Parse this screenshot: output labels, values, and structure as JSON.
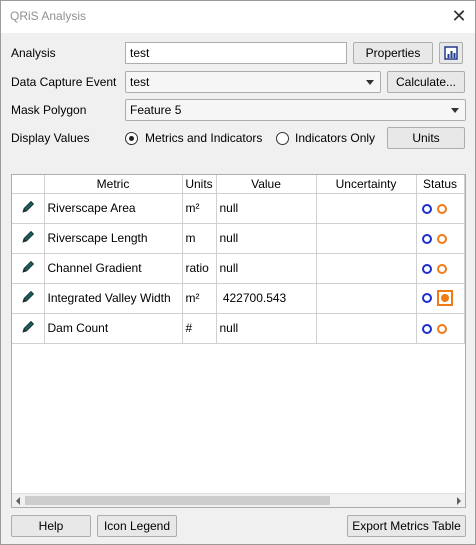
{
  "window": {
    "title": "QRiS Analysis"
  },
  "form": {
    "analysis_label": "Analysis",
    "analysis_value": "test",
    "properties_button": "Properties",
    "dce_label": "Data Capture Event",
    "dce_value": "test",
    "calculate_button": "Calculate...",
    "mask_label": "Mask Polygon",
    "mask_value": "Feature 5",
    "display_label": "Display Values",
    "radio_metrics": "Metrics and Indicators",
    "radio_indicators": "Indicators Only",
    "units_button": "Units",
    "selected_radio": "Metrics and Indicators"
  },
  "table": {
    "headers": [
      "",
      "Metric",
      "Units",
      "Value",
      "Uncertainty",
      "Status"
    ],
    "rows": [
      {
        "metric": "Riverscape Area",
        "units": "m²",
        "value": "null",
        "uncertainty": ""
      },
      {
        "metric": "Riverscape Length",
        "units": "m",
        "value": "null",
        "uncertainty": ""
      },
      {
        "metric": "Channel Gradient",
        "units": "ratio",
        "value": "null",
        "uncertainty": ""
      },
      {
        "metric": "Integrated Valley Width",
        "units": "m²",
        "value": " 422700.543",
        "uncertainty": ""
      },
      {
        "metric": "Dam Count",
        "units": "#",
        "value": "null",
        "uncertainty": ""
      }
    ]
  },
  "footer": {
    "help_button": "Help",
    "legend_button": "Icon Legend",
    "export_button": "Export Metrics Table"
  },
  "colors": {
    "status_blue": "#1c2fd0",
    "status_orange": "#f07a16"
  }
}
